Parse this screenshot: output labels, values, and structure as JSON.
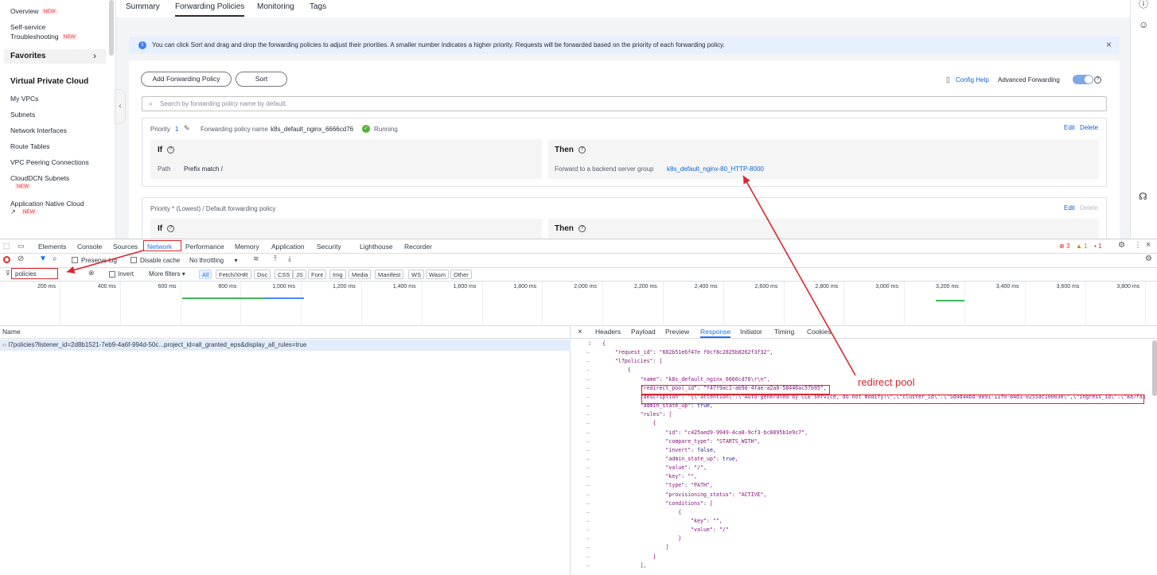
{
  "sidebar": {
    "new_badge": "NEW",
    "overview": "Overview",
    "self_service_1": "Self-service",
    "self_service_2": "Troubleshooting",
    "favorites": "Favorites",
    "section": "Virtual Private Cloud",
    "items": [
      "My VPCs",
      "Subnets",
      "Network Interfaces",
      "Route Tables",
      "VPC Peering Connections"
    ],
    "clouddcn": "CloudDCN Subnets",
    "app_native": "Application Native Cloud"
  },
  "tabs": [
    "Summary",
    "Forwarding Policies",
    "Monitoring",
    "Tags"
  ],
  "info": {
    "text": "You can click Sort and drag and drop the forwarding policies to adjust their priorities. A smaller number indicates a higher priority. Requests will be forwarded based on the priority of each forwarding policy."
  },
  "toolbar": {
    "add": "Add Forwarding Policy",
    "sort": "Sort",
    "config_help": "Config Help",
    "advanced": "Advanced Forwarding"
  },
  "search": {
    "placeholder": "Search by forwarding policy name by default."
  },
  "policy1": {
    "priority_label": "Priority",
    "priority": "1",
    "name_label": "Forwarding policy name",
    "name": "k8s_default_nginx_6666cd76",
    "status": "Running",
    "edit": "Edit",
    "delete": "Delete",
    "if": "If",
    "path_label": "Path",
    "path_value": "Prefix match /",
    "then": "Then",
    "forward_label": "Forward to a backend server group",
    "forward_value": "k8s_default_nginx-80_HTTP-8000"
  },
  "policy2": {
    "header": "Priority * (Lowest) / Default forwarding policy",
    "edit": "Edit",
    "delete": "Delete",
    "if": "If",
    "then": "Then"
  },
  "devtools": {
    "tabs": [
      "Elements",
      "Console",
      "Sources",
      "Network",
      "Performance",
      "Memory",
      "Application",
      "Security",
      "Lighthouse",
      "Recorder"
    ],
    "errors": "3",
    "warnings": "1",
    "issues": "1",
    "preserve_log": "Preserve log",
    "disable_cache": "Disable cache",
    "throttling": "No throttling",
    "filter_value": "policies",
    "invert": "Invert",
    "more_filters": "More filters",
    "filter_types": [
      "All",
      "Fetch/XHR",
      "Doc",
      "CSS",
      "JS",
      "Font",
      "Img",
      "Media",
      "Manifest",
      "WS",
      "Wasm",
      "Other"
    ],
    "timeline_ticks": [
      "200 ms",
      "400 ms",
      "600 ms",
      "800 ms",
      "1,000 ms",
      "1,200 ms",
      "1,400 ms",
      "1,600 ms",
      "1,800 ms",
      "2,000 ms",
      "2,200 ms",
      "2,400 ms",
      "2,600 ms",
      "2,800 ms",
      "3,000 ms",
      "3,200 ms",
      "3,400 ms",
      "3,600 ms",
      "3,800 ms"
    ],
    "name_header": "Name",
    "request": "l7policies?listener_id=2d8b1521-7eb9-4a6f-994d-50c...project_id=all_granted_eps&display_all_rules=true",
    "resp_tabs": [
      "Headers",
      "Payload",
      "Preview",
      "Response",
      "Initiator",
      "Timing",
      "Cookies"
    ]
  },
  "response_lines": [
    "{",
    "    \"request_id\": \"682b51e6f47e f0cf8c2825b8262f3f32\",",
    "    \"l7policies\": [",
    "        {",
    "            \"name\": \"k8s_default_nginx_6666cd76\\r\\n\",",
    "            \"redirect_pool_id\": \"f47f9ac1-ab9d-4fae-a2a0-58446ac57b95\",",
    "            \"description\": \"{\\\"attention\\\":\\\"Auto-generated by CCE service, do not modify!\\\",\\\"cluster_id\\\":\\\"5d4d44bd-0891-11f0-84d3-0255ac10003e\\\",\\\"ingress_id\\\":\\\"8a7fa1",
    "            \"admin_state_up\": true,",
    "            \"rules\": [",
    "                {",
    "                    \"id\": \"c425aed9-9949-4ca8-9cf3-bc8895b1e9c7\",",
    "                    \"compare_type\": \"STARTS_WITH\",",
    "                    \"invert\": false,",
    "                    \"admin_state_up\": true,",
    "                    \"value\": \"/\",",
    "                    \"key\": \"\",",
    "                    \"type\": \"PATH\",",
    "                    \"provisioning_status\": \"ACTIVE\",",
    "                    \"conditions\": [",
    "                        {",
    "                            \"key\": \"\",",
    "                            \"value\": \"/\"",
    "                        }",
    "                    ]",
    "                }",
    "            ],"
  ],
  "annotation": "redirect pool",
  "colors": {
    "accent": "#0d65d9",
    "devtools_blue": "#1a73e8",
    "annotation_red": "#d9272e",
    "running_green": "#50b432"
  }
}
